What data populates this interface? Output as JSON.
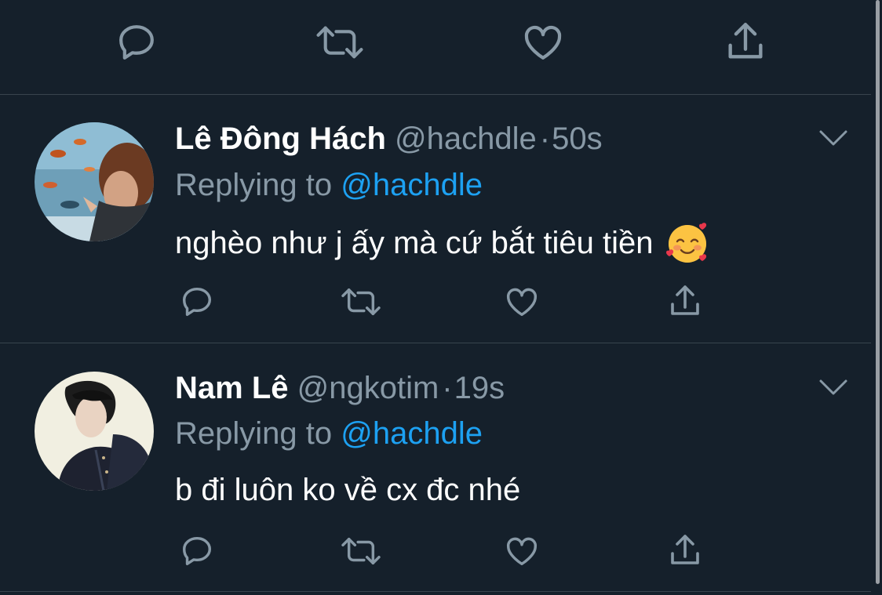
{
  "colors": {
    "background": "#15202b",
    "divider": "#38444d",
    "secondary_text": "#8899a6",
    "mention": "#1da1f2",
    "primary_text": "#ffffff"
  },
  "tweets": [
    {
      "name": "Lê Đông Hách",
      "handle": "@hachdle",
      "separator": "·",
      "time": "50s",
      "replying_prefix": "Replying to",
      "replying_handle": "@hachdle",
      "text": "nghèo như j ấy mà cứ bắt tiêu tiền",
      "emoji": "smiling-face-with-hearts"
    },
    {
      "name": "Nam Lê",
      "handle": "@ngkotim",
      "separator": "·",
      "time": "19s",
      "replying_prefix": "Replying to",
      "replying_handle": "@hachdle",
      "text": "b đi luôn ko về cx đc nhé"
    }
  ],
  "icons": {
    "reply": "reply-icon",
    "retweet": "retweet-icon",
    "like": "heart-icon",
    "share": "share-icon",
    "more": "chevron-down-icon"
  }
}
